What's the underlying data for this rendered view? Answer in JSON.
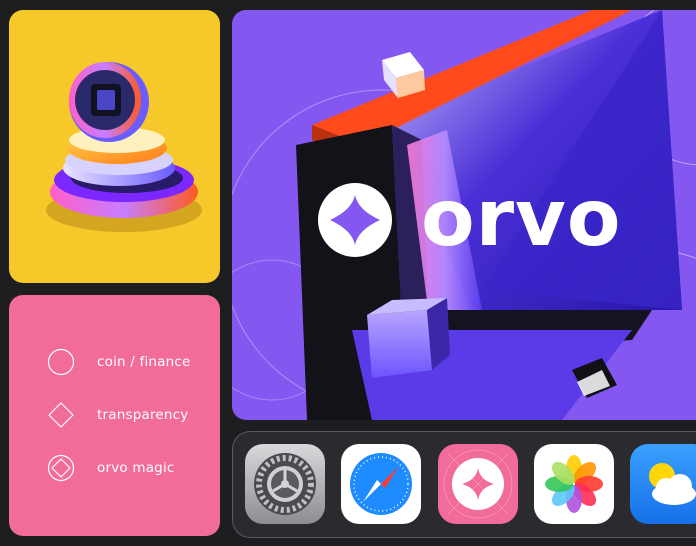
{
  "brand": {
    "name": "orvo",
    "accent_purple": "#8458f0",
    "accent_yellow": "#f7c82a",
    "accent_pink": "#f26c9b",
    "accent_orange": "#ff4a1c"
  },
  "legend": {
    "items": [
      {
        "icon": "circle-icon",
        "label": "coin / finance"
      },
      {
        "icon": "diamond-icon",
        "label": "transparency"
      },
      {
        "icon": "orvo-logo-icon",
        "label": "orvo magic"
      }
    ]
  },
  "dock": {
    "apps": [
      {
        "icon": "settings-app-icon"
      },
      {
        "icon": "safari-app-icon"
      },
      {
        "icon": "orvo-app-icon"
      },
      {
        "icon": "photos-app-icon"
      },
      {
        "icon": "weather-app-icon"
      }
    ]
  }
}
